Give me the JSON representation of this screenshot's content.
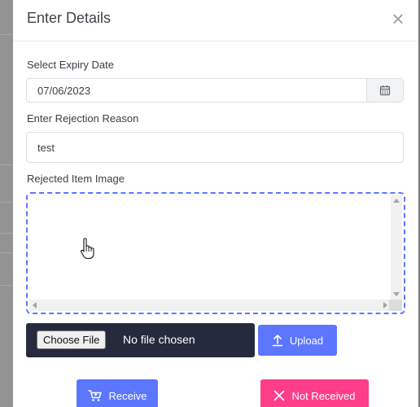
{
  "modal": {
    "title": "Enter Details",
    "close_symbol": "×"
  },
  "expiry": {
    "label": "Select Expiry Date",
    "value": "07/06/2023",
    "calendar_icon": "calendar-icon"
  },
  "rejection": {
    "label": "Enter Rejection Reason",
    "value": "test"
  },
  "image": {
    "label": "Rejected Item Image"
  },
  "file": {
    "choose_label": "Choose File",
    "status": "No file chosen"
  },
  "buttons": {
    "upload": "Upload",
    "upload_icon": "upload-arrow-icon",
    "receive": "Receive",
    "receive_icon": "cart-icon",
    "not_received": "Not Received",
    "not_received_icon": "x-icon"
  },
  "colors": {
    "primary": "#5c76ff",
    "danger": "#ff3d88",
    "file_bar": "#262a3d"
  }
}
